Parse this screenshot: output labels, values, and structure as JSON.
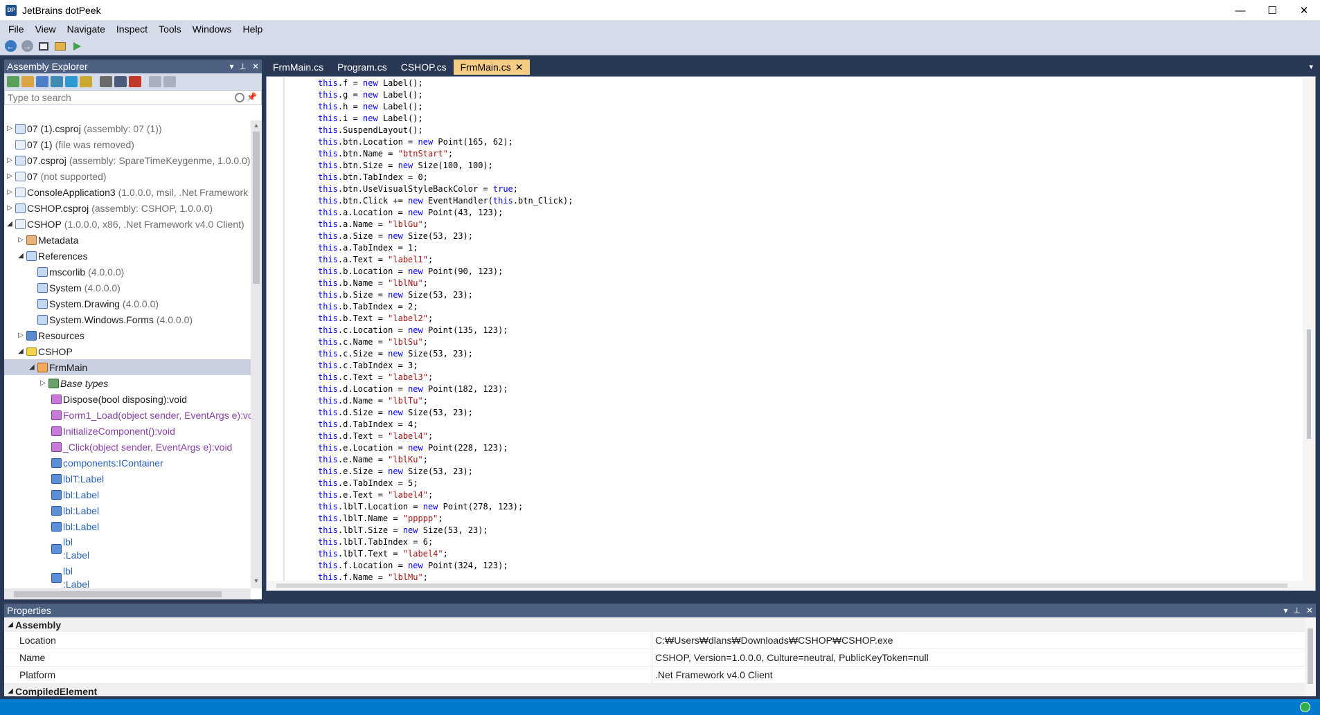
{
  "window": {
    "icon_text": "DP",
    "title": "JetBrains dotPeek",
    "controls": {
      "minimize": "—",
      "maximize": "☐",
      "close": "✕"
    }
  },
  "menu": [
    {
      "label": "File"
    },
    {
      "label": "View"
    },
    {
      "label": "Navigate"
    },
    {
      "label": "Inspect"
    },
    {
      "label": "Tools"
    },
    {
      "label": "Windows"
    },
    {
      "label": "Help"
    }
  ],
  "toolbar": {
    "back_glyph": "←",
    "forward_glyph": "→"
  },
  "assembly_explorer": {
    "title": "Assembly Explorer",
    "search_placeholder": "Type to search",
    "header_buttons": {
      "menu": "▾",
      "pin": "⊥",
      "close": "✕"
    },
    "tree": [
      {
        "expander": "▷",
        "label": "07 (1).csproj",
        "dim": "(assembly: 07 (1))"
      },
      {
        "expander": "",
        "label": "07 (1)",
        "dim": "(file was removed)"
      },
      {
        "expander": "▷",
        "label": "07.csproj",
        "dim": "(assembly: SpareTimeKeygenme, 1.0.0.0)"
      },
      {
        "expander": "▷",
        "label": "07",
        "dim": "(not supported)"
      },
      {
        "expander": "▷",
        "label": "ConsoleApplication3",
        "dim": "(1.0.0.0, msil, .Net Framework"
      },
      {
        "expander": "▷",
        "label": "CSHOP.csproj",
        "dim": "(assembly: CSHOP, 1.0.0.0)"
      },
      {
        "expander": "◢",
        "label": "CSHOP",
        "dim": "(1.0.0.0, x86, .Net Framework v4.0 Client)"
      },
      {
        "expander": "▷",
        "label": "Metadata",
        "dim": ""
      },
      {
        "expander": "◢",
        "label": "References",
        "dim": ""
      },
      {
        "expander": "",
        "label": "mscorlib",
        "dim": "(4.0.0.0)"
      },
      {
        "expander": "",
        "label": "System",
        "dim": "(4.0.0.0)"
      },
      {
        "expander": "",
        "label": "System.Drawing",
        "dim": "(4.0.0.0)"
      },
      {
        "expander": "",
        "label": "System.Windows.Forms",
        "dim": "(4.0.0.0)"
      },
      {
        "expander": "▷",
        "label": "Resources",
        "dim": ""
      },
      {
        "expander": "◢",
        "label": "CSHOP",
        "dim": ""
      },
      {
        "expander": "◢",
        "label": "FrmMain",
        "dim": ""
      },
      {
        "expander": "▷",
        "label": "Base types",
        "dim": ""
      },
      {
        "expander": "",
        "label": "Dispose(bool disposing):void",
        "dim": ""
      },
      {
        "expander": "",
        "label": "Form1_Load(object sender, EventArgs e):vo",
        "dim": ""
      },
      {
        "expander": "",
        "label": "InitializeComponent():void",
        "dim": ""
      },
      {
        "expander": "",
        "label": "_Click(object sender, EventArgs e):void",
        "dim": ""
      },
      {
        "expander": "",
        "label": "components:IContainer",
        "dim": ""
      },
      {
        "expander": "",
        "label": "lblT:Label",
        "dim": ""
      },
      {
        "expander": "",
        "label": "lbl:Label",
        "dim": ""
      },
      {
        "expander": "",
        "label": "lbl:Label",
        "dim": ""
      },
      {
        "expander": "",
        "label": "lbl:Label",
        "dim": ""
      },
      {
        "expander": "",
        "label": "lbl",
        "label2": ":Label",
        "dim": ""
      },
      {
        "expander": "",
        "label": "lbl",
        "label2": ":Label",
        "dim": ""
      }
    ]
  },
  "editor": {
    "tabs": [
      {
        "label": "FrmMain.cs",
        "active": false
      },
      {
        "label": "Program.cs",
        "active": false
      },
      {
        "label": "CSHOP.cs",
        "active": false
      },
      {
        "label": "FrmMain.cs",
        "active": true
      }
    ],
    "tab_close_glyph": "✕",
    "dropdown_glyph": "▾",
    "code": [
      [
        [
          "t",
          "this"
        ],
        [
          "p",
          ".f = "
        ],
        [
          "k",
          "new"
        ],
        [
          "p",
          " Label();"
        ]
      ],
      [
        [
          "t",
          "this"
        ],
        [
          "p",
          ".g = "
        ],
        [
          "k",
          "new"
        ],
        [
          "p",
          " Label();"
        ]
      ],
      [
        [
          "t",
          "this"
        ],
        [
          "p",
          ".h = "
        ],
        [
          "k",
          "new"
        ],
        [
          "p",
          " Label();"
        ]
      ],
      [
        [
          "t",
          "this"
        ],
        [
          "p",
          ".i = "
        ],
        [
          "k",
          "new"
        ],
        [
          "p",
          " Label();"
        ]
      ],
      [
        [
          "t",
          "this"
        ],
        [
          "p",
          ".SuspendLayout();"
        ]
      ],
      [
        [
          "t",
          "this"
        ],
        [
          "p",
          ".btn.Location = "
        ],
        [
          "k",
          "new"
        ],
        [
          "p",
          " Point(165, 62);"
        ]
      ],
      [
        [
          "t",
          "this"
        ],
        [
          "p",
          ".btn.Name = "
        ],
        [
          "s",
          "\"btnStart\""
        ],
        [
          "p",
          ";"
        ]
      ],
      [
        [
          "t",
          "this"
        ],
        [
          "p",
          ".btn.Size = "
        ],
        [
          "k",
          "new"
        ],
        [
          "p",
          " Size(100, 100);"
        ]
      ],
      [
        [
          "t",
          "this"
        ],
        [
          "p",
          ".btn.TabIndex = 0;"
        ]
      ],
      [
        [
          "t",
          "this"
        ],
        [
          "p",
          ".btn.UseVisualStyleBackColor = "
        ],
        [
          "k",
          "true"
        ],
        [
          "p",
          ";"
        ]
      ],
      [
        [
          "t",
          "this"
        ],
        [
          "p",
          ".btn.Click += "
        ],
        [
          "k",
          "new"
        ],
        [
          "p",
          " EventHandler("
        ],
        [
          "t",
          "this"
        ],
        [
          "p",
          ".btn_Click);"
        ]
      ],
      [
        [
          "t",
          "this"
        ],
        [
          "p",
          ".a.Location = "
        ],
        [
          "k",
          "new"
        ],
        [
          "p",
          " Point(43, 123);"
        ]
      ],
      [
        [
          "t",
          "this"
        ],
        [
          "p",
          ".a.Name = "
        ],
        [
          "s",
          "\"lblGu\""
        ],
        [
          "p",
          ";"
        ]
      ],
      [
        [
          "t",
          "this"
        ],
        [
          "p",
          ".a.Size = "
        ],
        [
          "k",
          "new"
        ],
        [
          "p",
          " Size(53, 23);"
        ]
      ],
      [
        [
          "t",
          "this"
        ],
        [
          "p",
          ".a.TabIndex = 1;"
        ]
      ],
      [
        [
          "t",
          "this"
        ],
        [
          "p",
          ".a.Text = "
        ],
        [
          "s",
          "\"label1\""
        ],
        [
          "p",
          ";"
        ]
      ],
      [
        [
          "t",
          "this"
        ],
        [
          "p",
          ".b.Location = "
        ],
        [
          "k",
          "new"
        ],
        [
          "p",
          " Point(90, 123);"
        ]
      ],
      [
        [
          "t",
          "this"
        ],
        [
          "p",
          ".b.Name = "
        ],
        [
          "s",
          "\"lblNu\""
        ],
        [
          "p",
          ";"
        ]
      ],
      [
        [
          "t",
          "this"
        ],
        [
          "p",
          ".b.Size = "
        ],
        [
          "k",
          "new"
        ],
        [
          "p",
          " Size(53, 23);"
        ]
      ],
      [
        [
          "t",
          "this"
        ],
        [
          "p",
          ".b.TabIndex = 2;"
        ]
      ],
      [
        [
          "t",
          "this"
        ],
        [
          "p",
          ".b.Text = "
        ],
        [
          "s",
          "\"label2\""
        ],
        [
          "p",
          ";"
        ]
      ],
      [
        [
          "t",
          "this"
        ],
        [
          "p",
          ".c.Location = "
        ],
        [
          "k",
          "new"
        ],
        [
          "p",
          " Point(135, 123);"
        ]
      ],
      [
        [
          "t",
          "this"
        ],
        [
          "p",
          ".c.Name = "
        ],
        [
          "s",
          "\"lblSu\""
        ],
        [
          "p",
          ";"
        ]
      ],
      [
        [
          "t",
          "this"
        ],
        [
          "p",
          ".c.Size = "
        ],
        [
          "k",
          "new"
        ],
        [
          "p",
          " Size(53, 23);"
        ]
      ],
      [
        [
          "t",
          "this"
        ],
        [
          "p",
          ".c.TabIndex = 3;"
        ]
      ],
      [
        [
          "t",
          "this"
        ],
        [
          "p",
          ".c.Text = "
        ],
        [
          "s",
          "\"label3\""
        ],
        [
          "p",
          ";"
        ]
      ],
      [
        [
          "t",
          "this"
        ],
        [
          "p",
          ".d.Location = "
        ],
        [
          "k",
          "new"
        ],
        [
          "p",
          " Point(182, 123);"
        ]
      ],
      [
        [
          "t",
          "this"
        ],
        [
          "p",
          ".d.Name = "
        ],
        [
          "s",
          "\"lblTu\""
        ],
        [
          "p",
          ";"
        ]
      ],
      [
        [
          "t",
          "this"
        ],
        [
          "p",
          ".d.Size = "
        ],
        [
          "k",
          "new"
        ],
        [
          "p",
          " Size(53, 23);"
        ]
      ],
      [
        [
          "t",
          "this"
        ],
        [
          "p",
          ".d.TabIndex = 4;"
        ]
      ],
      [
        [
          "t",
          "this"
        ],
        [
          "p",
          ".d.Text = "
        ],
        [
          "s",
          "\"label4\""
        ],
        [
          "p",
          ";"
        ]
      ],
      [
        [
          "t",
          "this"
        ],
        [
          "p",
          ".e.Location = "
        ],
        [
          "k",
          "new"
        ],
        [
          "p",
          " Point(228, 123);"
        ]
      ],
      [
        [
          "t",
          "this"
        ],
        [
          "p",
          ".e.Name = "
        ],
        [
          "s",
          "\"lblKu\""
        ],
        [
          "p",
          ";"
        ]
      ],
      [
        [
          "t",
          "this"
        ],
        [
          "p",
          ".e.Size = "
        ],
        [
          "k",
          "new"
        ],
        [
          "p",
          " Size(53, 23);"
        ]
      ],
      [
        [
          "t",
          "this"
        ],
        [
          "p",
          ".e.TabIndex = 5;"
        ]
      ],
      [
        [
          "t",
          "this"
        ],
        [
          "p",
          ".e.Text = "
        ],
        [
          "s",
          "\"label4\""
        ],
        [
          "p",
          ";"
        ]
      ],
      [
        [
          "t",
          "this"
        ],
        [
          "p",
          ".lblT.Location = "
        ],
        [
          "k",
          "new"
        ],
        [
          "p",
          " Point(278, 123);"
        ]
      ],
      [
        [
          "t",
          "this"
        ],
        [
          "p",
          ".lblT.Name = "
        ],
        [
          "s",
          "\"ppppp\""
        ],
        [
          "p",
          ";"
        ]
      ],
      [
        [
          "t",
          "this"
        ],
        [
          "p",
          ".lblT.Size = "
        ],
        [
          "k",
          "new"
        ],
        [
          "p",
          " Size(53, 23);"
        ]
      ],
      [
        [
          "t",
          "this"
        ],
        [
          "p",
          ".lblT.TabIndex = 6;"
        ]
      ],
      [
        [
          "t",
          "this"
        ],
        [
          "p",
          ".lblT.Text = "
        ],
        [
          "s",
          "\"label4\""
        ],
        [
          "p",
          ";"
        ]
      ],
      [
        [
          "t",
          "this"
        ],
        [
          "p",
          ".f.Location = "
        ],
        [
          "k",
          "new"
        ],
        [
          "p",
          " Point(324, 123);"
        ]
      ],
      [
        [
          "t",
          "this"
        ],
        [
          "p",
          ".f.Name = "
        ],
        [
          "s",
          "\"lblMu\""
        ],
        [
          "p",
          ";"
        ]
      ]
    ]
  },
  "properties": {
    "title": "Properties",
    "header_buttons": {
      "menu": "▾",
      "pin": "⊥",
      "close": "✕"
    },
    "groups": [
      {
        "name": "Assembly",
        "expander": "◢",
        "rows": [
          {
            "name": "Location",
            "value": "C:₩Users₩dlans₩Downloads₩CSHOP₩CSHOP.exe"
          },
          {
            "name": "Name",
            "value": "CSHOP, Version=1.0.0.0, Culture=neutral, PublicKeyToken=null"
          },
          {
            "name": "Platform",
            "value": ".Net Framework v4.0 Client"
          }
        ]
      },
      {
        "name": "CompiledElement",
        "expander": "◢",
        "rows": []
      }
    ]
  },
  "colors": {
    "frame": "#293955",
    "panel_header": "#4d6082",
    "active_tab": "#f5cc84",
    "status_bar": "#007acc",
    "keyword": "#0000ff",
    "string": "#a31515"
  }
}
